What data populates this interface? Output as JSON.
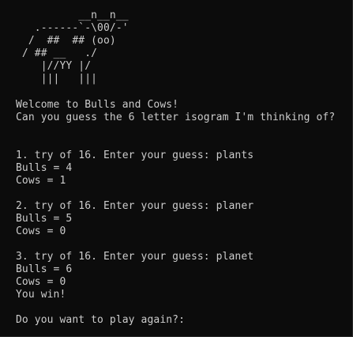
{
  "console": {
    "banner": [
      "          __n__n__",
      "   .------`-\\00/-'",
      "  /  ##  ## (oo)",
      " / ## __   ./",
      "    |//YY |/",
      "    |||   |||"
    ],
    "welcome": "Welcome to Bulls and Cows!",
    "prompt": "Can you guess the 6 letter isogram I'm thinking of?",
    "attempts": [
      {
        "try_line": "1. try of 16. Enter your guess: plants",
        "bulls_line": "Bulls = 4",
        "cows_line": "Cows = 1"
      },
      {
        "try_line": "2. try of 16. Enter your guess: planer",
        "bulls_line": "Bulls = 5",
        "cows_line": "Cows = 0"
      },
      {
        "try_line": "3. try of 16. Enter your guess: planet",
        "bulls_line": "Bulls = 6",
        "cows_line": "Cows = 0"
      }
    ],
    "result": "You win!",
    "play_again": "Do you want to play again?:"
  }
}
